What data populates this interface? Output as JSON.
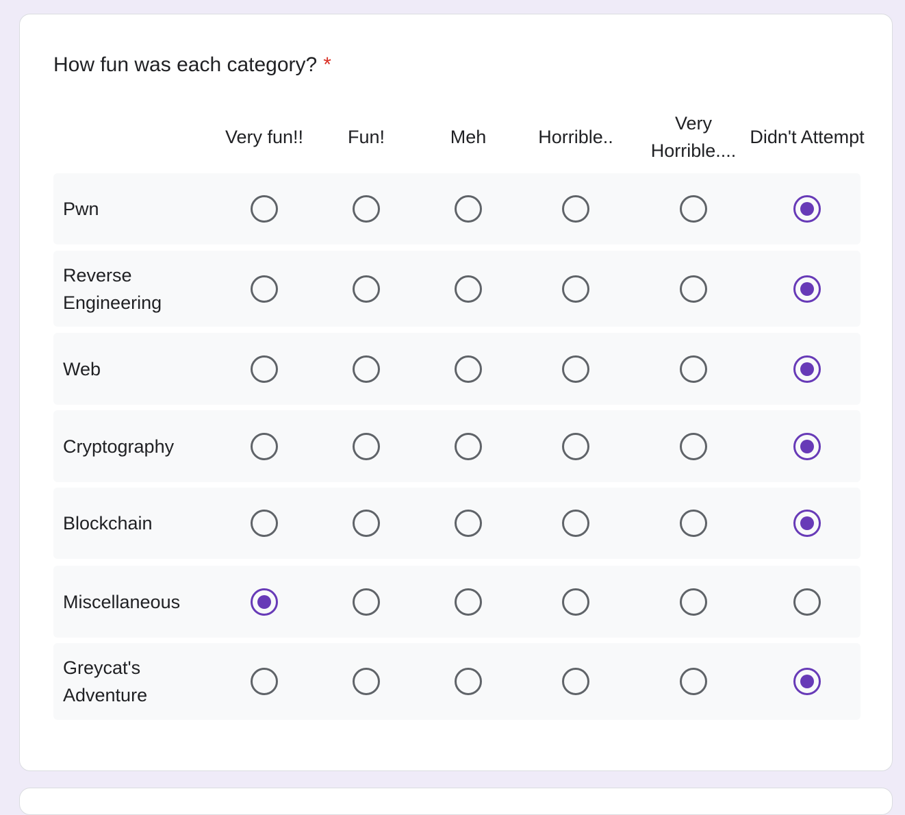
{
  "question": {
    "title": "How fun was each category?",
    "required_marker": "*"
  },
  "columns": [
    "Very fun!!",
    "Fun!",
    "Meh",
    "Horrible..",
    "Very Horrible....",
    "Didn't Attempt"
  ],
  "rows": [
    {
      "label": "Pwn",
      "selected": 5
    },
    {
      "label": "Reverse Engineering",
      "selected": 5
    },
    {
      "label": "Web",
      "selected": 5
    },
    {
      "label": "Cryptography",
      "selected": 5
    },
    {
      "label": "Blockchain",
      "selected": 5
    },
    {
      "label": "Miscellaneous",
      "selected": 0
    },
    {
      "label": "Greycat's Adventure",
      "selected": 5
    }
  ],
  "colors": {
    "accent": "#673ab7",
    "required": "#d93025",
    "radio_unchecked": "#5f6368",
    "row_background": "#f8f9fa",
    "page_background": "#efebf8"
  }
}
